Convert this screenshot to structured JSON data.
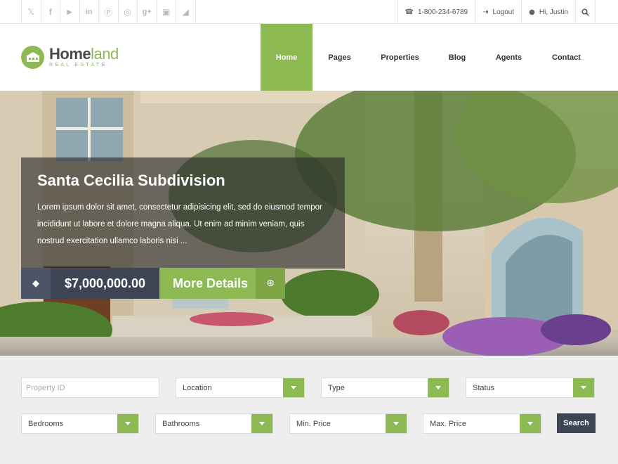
{
  "topbar": {
    "social_icons": [
      "twitter-icon",
      "facebook-icon",
      "youtube-icon",
      "linkedin-icon",
      "pinterest-icon",
      "dribbble-icon",
      "google-plus-icon",
      "instagram-icon",
      "rss-icon"
    ],
    "phone": "1-800-234-6789",
    "logout": "Logout",
    "greeting": "Hi, Justin"
  },
  "brand": {
    "name_bold": "Home",
    "name_light": "land",
    "tagline": "REAL ESTATE",
    "accent_color": "#8db952",
    "dark_color": "#3d4554"
  },
  "nav": {
    "items": [
      "Home",
      "Pages",
      "Properties",
      "Blog",
      "Agents",
      "Contact"
    ],
    "active": "Home"
  },
  "hero": {
    "title": "Santa Cecilia Subdivision",
    "description": "Lorem ipsum dolor sit amet, consectetur adipisicing elit, sed do eiusmod tempor incididunt ut labore et dolore magna aliqua. Ut enim ad minim veniam, quis nostrud exercitation ullamco laboris nisi ...",
    "price": "$7,000,000.00",
    "more_label": "More Details"
  },
  "search": {
    "property_id_placeholder": "Property ID",
    "location": "Location",
    "type": "Type",
    "status": "Status",
    "bedrooms": "Bedrooms",
    "bathrooms": "Bathrooms",
    "min_price": "Min. Price",
    "max_price": "Max. Price",
    "button": "Search"
  }
}
